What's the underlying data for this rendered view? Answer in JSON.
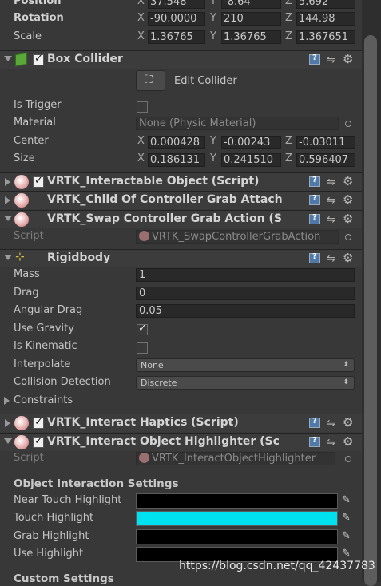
{
  "transform": {
    "position": {
      "label": "Position",
      "x": "37.548",
      "y": "-8.64",
      "z": "5.692"
    },
    "rotation": {
      "label": "Rotation",
      "x": "-90.0000",
      "y": "210",
      "z": "144.98"
    },
    "scale": {
      "label": "Scale",
      "x": "1.36765",
      "y": "1.36765",
      "z": "1.367651"
    },
    "axis_x": "X",
    "axis_y": "Y",
    "axis_z": "Z"
  },
  "box_collider": {
    "title": "Box Collider",
    "edit_label": "Edit Collider",
    "is_trigger_label": "Is Trigger",
    "material_label": "Material",
    "material_value": "None (Physic Material)",
    "center_label": "Center",
    "center": {
      "x": "0.000428",
      "y": "-0.00243",
      "z": "-0.03011"
    },
    "size_label": "Size",
    "size": {
      "x": "0.186131",
      "y": "0.241510",
      "z": "0.596407"
    }
  },
  "components": {
    "interactable": "VRTK_Interactable Object (Script)",
    "child_grab": "VRTK_Child Of Controller Grab Attach",
    "swap_grab": "VRTK_Swap Controller Grab Action (S",
    "script_label": "Script",
    "swap_script_value": "VRTK_SwapControllerGrabAction"
  },
  "rigidbody": {
    "title": "Rigidbody",
    "mass_label": "Mass",
    "mass": "1",
    "drag_label": "Drag",
    "drag": "0",
    "angular_drag_label": "Angular Drag",
    "angular_drag": "0.05",
    "use_gravity_label": "Use Gravity",
    "is_kinematic_label": "Is Kinematic",
    "interpolate_label": "Interpolate",
    "interpolate": "None",
    "collision_label": "Collision Detection",
    "collision": "Discrete",
    "constraints_label": "Constraints"
  },
  "haptics": {
    "title": "VRTK_Interact Haptics (Script)"
  },
  "highlighter": {
    "title": "VRTK_Interact Object Highlighter (Sc",
    "script_label": "Script",
    "script_value": "VRTK_InteractObjectHighlighter",
    "section": "Object Interaction Settings",
    "near_touch_label": "Near Touch Highlight",
    "touch_label": "Touch Highlight",
    "grab_label": "Grab Highlight",
    "use_label": "Use Highlight",
    "colors": {
      "near_touch": "#000000",
      "touch": "#00e1f0",
      "grab": "#000000",
      "use": "#000000"
    },
    "custom_section": "Custom Settings"
  },
  "watermark": "https://blog.csdn.net/qq_42437783"
}
